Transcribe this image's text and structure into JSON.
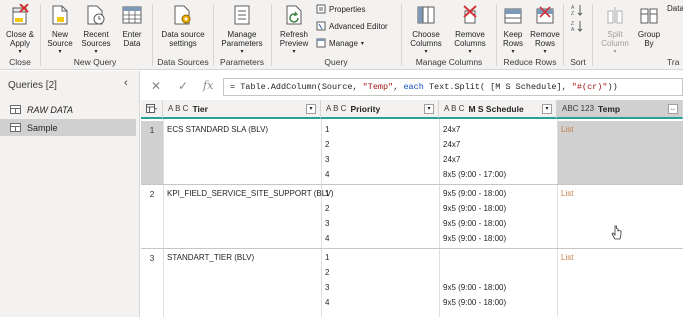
{
  "ribbon": {
    "close": {
      "btn1_l1": "Close &",
      "btn1_l2": "Apply",
      "label": "Close"
    },
    "new_query": {
      "new_l1": "New",
      "new_l2": "Source",
      "recent_l1": "Recent",
      "recent_l2": "Sources",
      "enter_l1": "Enter",
      "enter_l2": "Data",
      "label": "New Query"
    },
    "data_sources": {
      "btn_l1": "Data source",
      "btn_l2": "settings",
      "label": "Data Sources"
    },
    "parameters": {
      "btn_l1": "Manage",
      "btn_l2": "Parameters",
      "label": "Parameters"
    },
    "query": {
      "refresh_l1": "Refresh",
      "refresh_l2": "Preview",
      "properties": "Properties",
      "advanced": "Advanced Editor",
      "manage": "Manage",
      "label": "Query"
    },
    "manage_columns": {
      "choose_l1": "Choose",
      "choose_l2": "Columns",
      "remove_l1": "Remove",
      "remove_l2": "Columns",
      "label": "Manage Columns"
    },
    "reduce_rows": {
      "keep_l1": "Keep",
      "keep_l2": "Rows",
      "remove_l1": "Remove",
      "remove_l2": "Rows",
      "label": "Reduce Rows"
    },
    "sort": {
      "label": "Sort"
    },
    "transform": {
      "split_l1": "Split",
      "split_l2": "Column",
      "group_l1": "Group",
      "group_l2": "By",
      "data_partial": "Data",
      "label_partial": "Tra"
    }
  },
  "queries": {
    "title": "Queries [2]",
    "items": [
      {
        "name": "RAW DATA"
      },
      {
        "name": "Sample"
      }
    ]
  },
  "formula": {
    "prefix": "= Table.AddColumn(Source, ",
    "str1": "\"Temp\"",
    "mid": ", ",
    "kw": "each",
    "mid2": " Text.Split( [M S Schedule], ",
    "str2": "\"#(cr)\"",
    "suffix": "))"
  },
  "grid": {
    "columns": [
      {
        "type": "A B C",
        "name": "Tier"
      },
      {
        "type": "A B C",
        "name": "Priority"
      },
      {
        "type": "A B C",
        "name": "M S Schedule"
      },
      {
        "type": "ABC 123",
        "name": "Temp"
      }
    ],
    "rows": [
      {
        "num": "1",
        "tier": "ECS STANDARD SLA (BLV)",
        "priority": [
          "1",
          "2",
          "3",
          "4"
        ],
        "schedule": [
          "24x7",
          "24x7",
          "24x7",
          "8x5 (9:00 - 17:00)"
        ],
        "temp": "List"
      },
      {
        "num": "2",
        "tier": "KPI_FIELD_SERVICE_SITE_SUPPORT (BLV)",
        "priority": [
          "1",
          "2",
          "3",
          "4"
        ],
        "schedule": [
          "9x5 (9:00 - 18:00)",
          "9x5 (9:00 - 18:00)",
          "9x5 (9:00 - 18:00)",
          "9x5 (9:00 - 18:00)"
        ],
        "temp": "List"
      },
      {
        "num": "3",
        "tier": "STANDART_TIER (BLV)",
        "priority": [
          "1",
          "2",
          "3",
          "4"
        ],
        "schedule": [
          "",
          "",
          "9x5 (9:00 - 18:00)",
          "9x5 (9:00 - 18:00)"
        ],
        "temp": "List"
      }
    ]
  },
  "colors": {
    "accent_teal": "#2aa09a",
    "list_link": "#c77d3e",
    "selected_bg": "#d0d0d0"
  }
}
